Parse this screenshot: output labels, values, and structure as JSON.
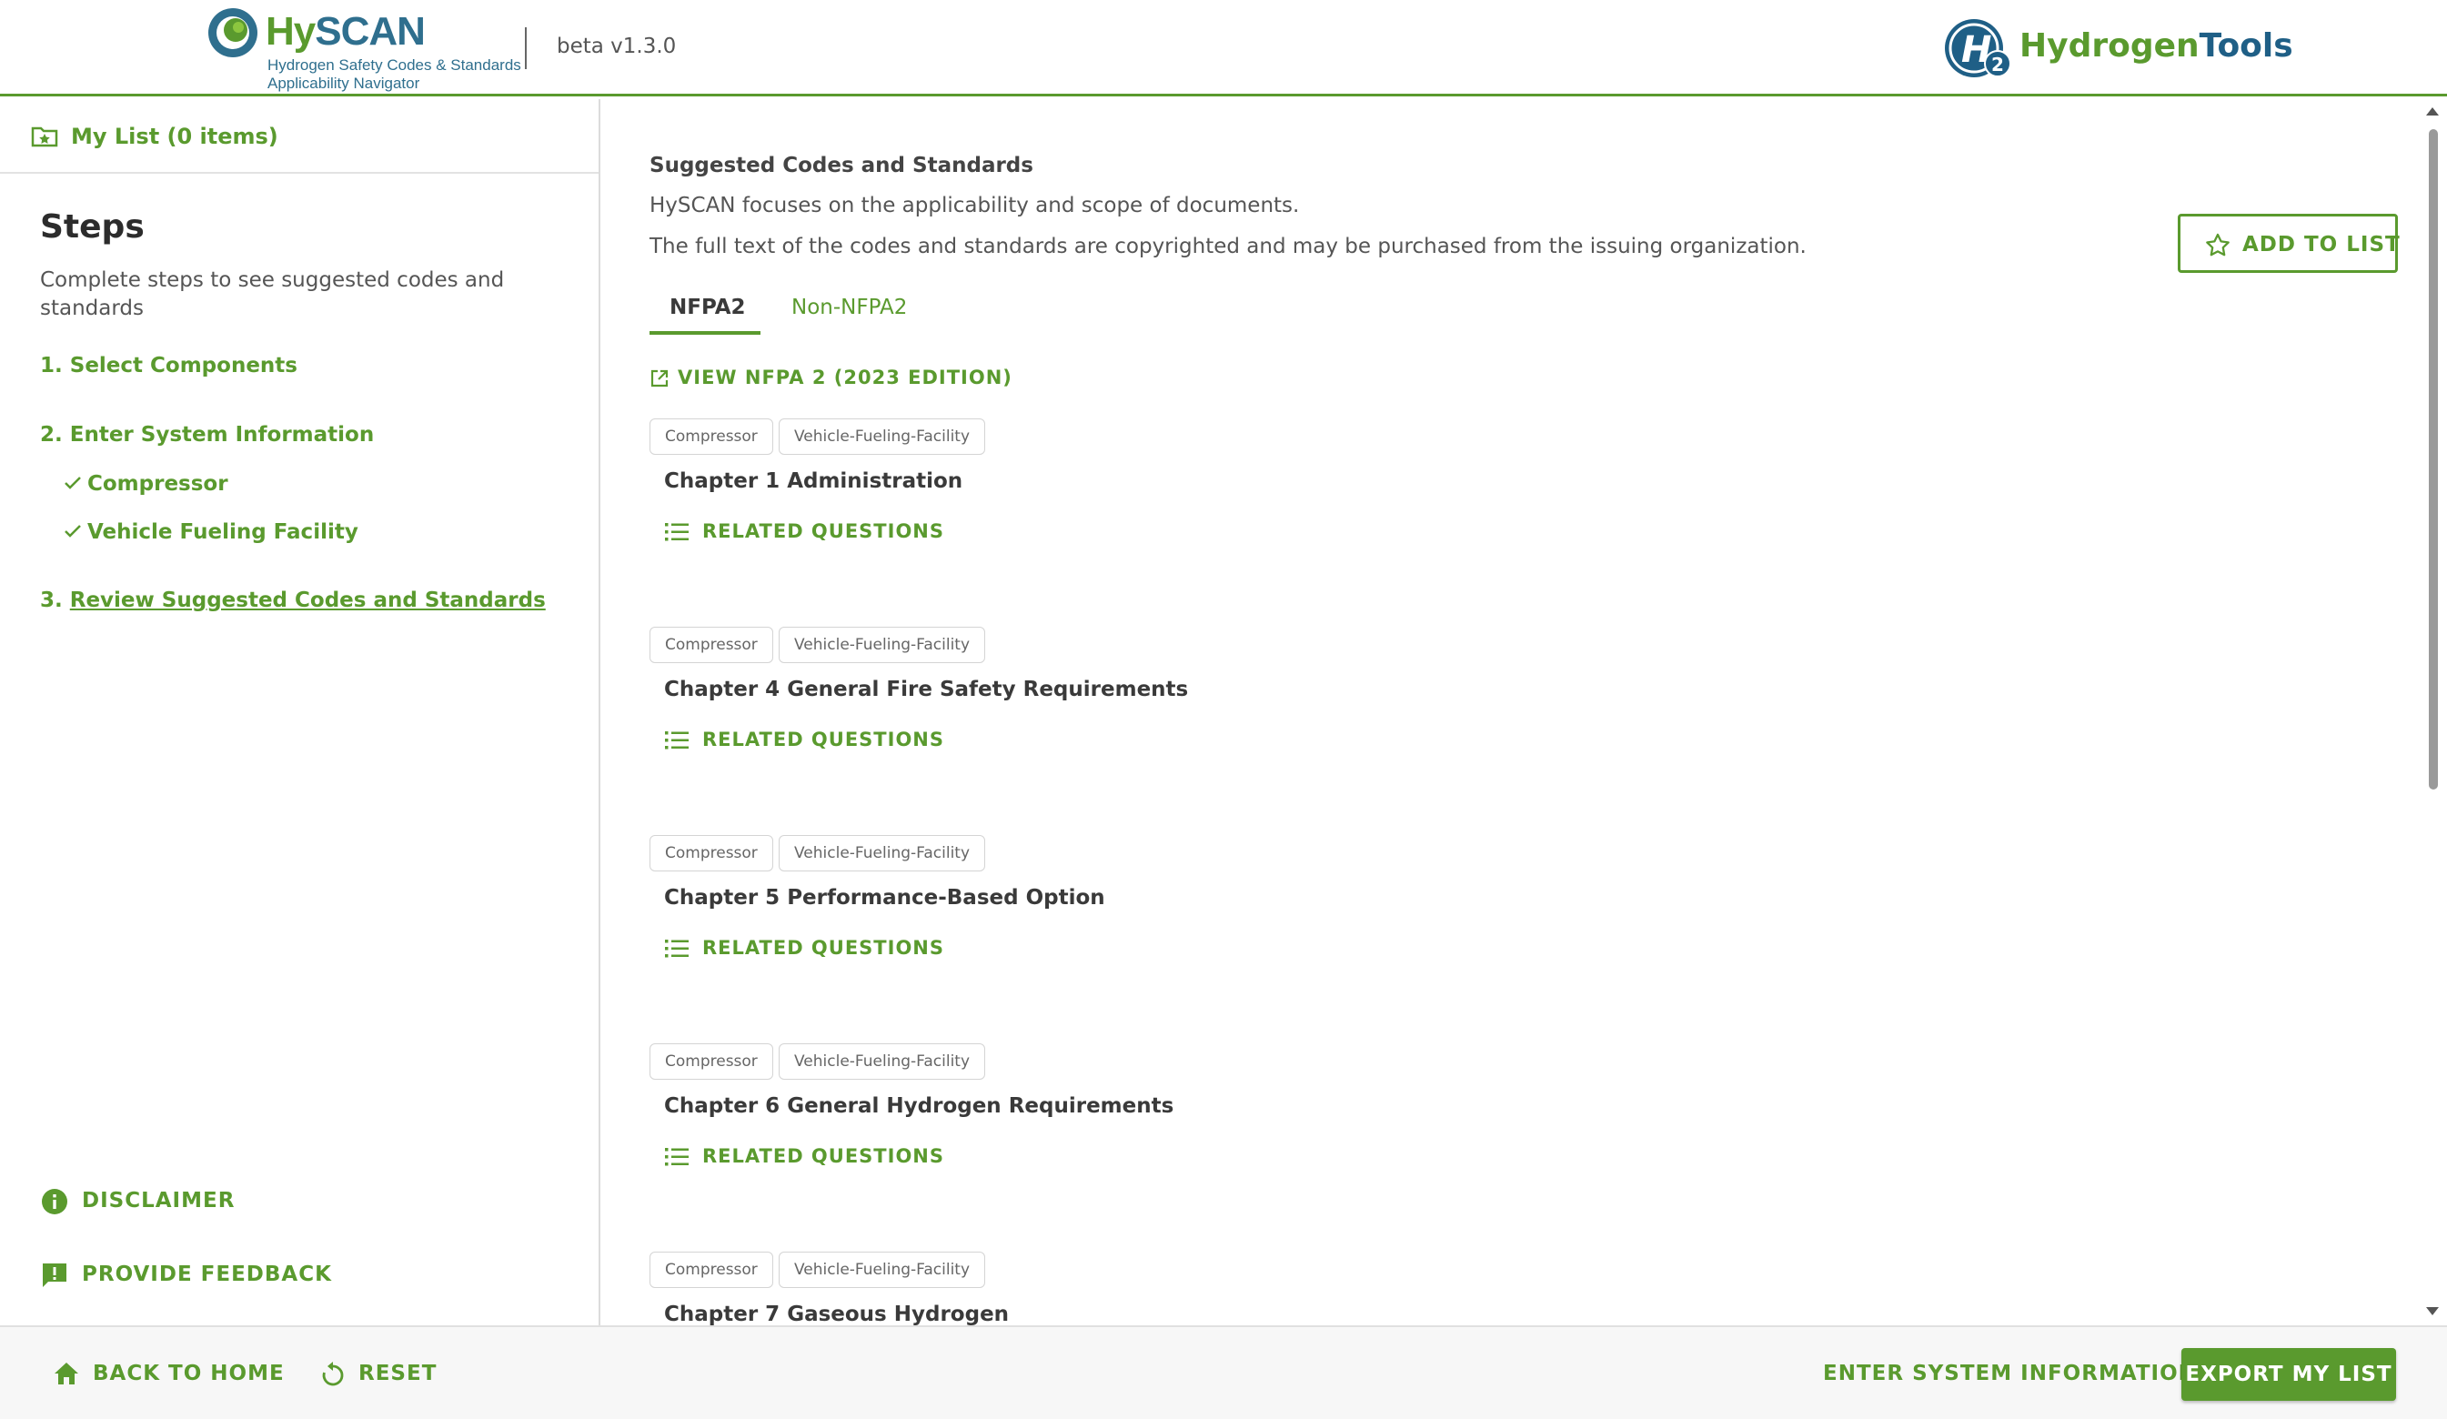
{
  "header": {
    "logo_name": "HySCAN",
    "logo_sub1": "Hydrogen Safety Codes & Standards",
    "logo_sub2": "Applicability Navigator",
    "version": "beta v1.3.0",
    "partner_logo_part1": "Hydrogen",
    "partner_logo_part2": "Tools"
  },
  "sidebar": {
    "my_list_label": "My List (0 items)",
    "steps_title": "Steps",
    "steps_description": "Complete steps to see suggested codes and standards",
    "step1": "1. Select Components",
    "step2": "2. Enter System Information",
    "substeps": [
      "Compressor",
      "Vehicle Fueling Facility"
    ],
    "step3_prefix": "3. ",
    "step3_link": "Review Suggested Codes and Standards",
    "disclaimer": "DISCLAIMER",
    "feedback": "PROVIDE FEEDBACK"
  },
  "main": {
    "section_title": "Suggested Codes and Standards",
    "line1": "HySCAN focuses on the applicability and scope of documents.",
    "line2": "The full text of the codes and standards are copyrighted and may be purchased from the issuing organization.",
    "add_to_list": "ADD TO LIST",
    "tabs": [
      "NFPA2",
      "Non-NFPA2"
    ],
    "active_tab": "NFPA2",
    "view_link": "VIEW NFPA 2 (2023 EDITION)",
    "related_label": "RELATED QUESTIONS",
    "items": [
      {
        "tags": [
          "Compressor",
          "Vehicle-Fueling-Facility"
        ],
        "title": "Chapter 1 Administration"
      },
      {
        "tags": [
          "Compressor",
          "Vehicle-Fueling-Facility"
        ],
        "title": "Chapter 4 General Fire Safety Requirements"
      },
      {
        "tags": [
          "Compressor",
          "Vehicle-Fueling-Facility"
        ],
        "title": "Chapter 5 Performance-Based Option"
      },
      {
        "tags": [
          "Compressor",
          "Vehicle-Fueling-Facility"
        ],
        "title": "Chapter 6 General Hydrogen Requirements"
      },
      {
        "tags": [
          "Compressor",
          "Vehicle-Fueling-Facility"
        ],
        "title": "Chapter 7 Gaseous Hydrogen"
      }
    ]
  },
  "footer": {
    "back_home": "BACK TO HOME",
    "reset": "RESET",
    "enter_system": "ENTER SYSTEM INFORMATION",
    "export": "EXPORT MY LIST"
  },
  "colors": {
    "brand_green": "#5a9a2e",
    "brand_blue": "#2f6f8e"
  }
}
